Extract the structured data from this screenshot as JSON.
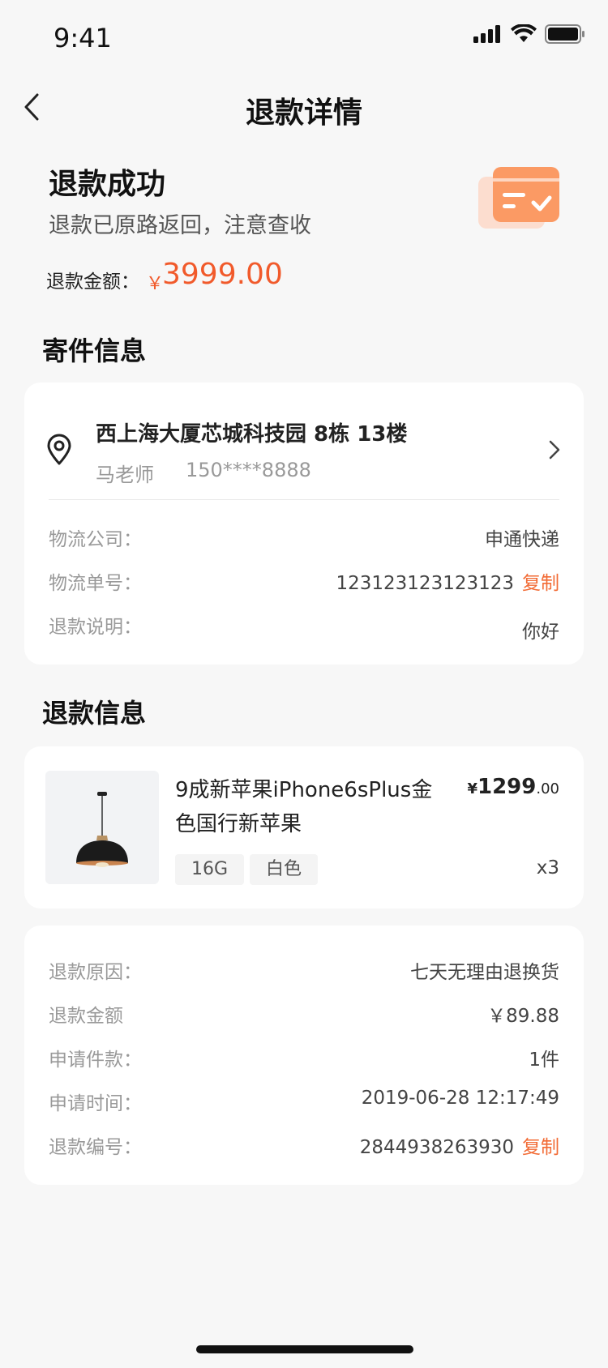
{
  "status_bar": {
    "time": "9:41"
  },
  "nav": {
    "title": "退款详情"
  },
  "summary": {
    "title": "退款成功",
    "subtitle": "退款已原路返回，注意查收",
    "amount_label": "退款金额：",
    "currency": "￥",
    "amount": "3999.00"
  },
  "shipping_section": {
    "title": "寄件信息",
    "address": "西上海大厦芯城科技园 8栋 13楼",
    "contact_name": "马老师",
    "contact_phone": "150****8888",
    "rows": [
      {
        "label": "物流公司：",
        "value": "申通快递"
      },
      {
        "label": "物流单号：",
        "value": "123123123123123",
        "action": "复制"
      },
      {
        "label": "退款说明：",
        "value": "你好"
      }
    ]
  },
  "refund_section": {
    "title": "退款信息",
    "product": {
      "title": "9成新苹果iPhone6sPlus金色国行新苹果",
      "currency": "¥",
      "price_int": "1299",
      "price_dec": ".00",
      "tags": [
        "16G",
        "白色"
      ],
      "qty": "x3"
    },
    "rows": [
      {
        "label": "退款原因：",
        "value": "七天无理由退换货"
      },
      {
        "label": "退款金额",
        "value": "￥89.88"
      },
      {
        "label": "申请件款：",
        "value": "1件"
      },
      {
        "label": "申请时间：",
        "value": "2019-06-28 12:17:49"
      },
      {
        "label": "退款编号：",
        "value": "2844938263930",
        "action": "复制"
      }
    ]
  },
  "colors": {
    "accent": "#f15a2b",
    "background": "#f7f7f7"
  }
}
